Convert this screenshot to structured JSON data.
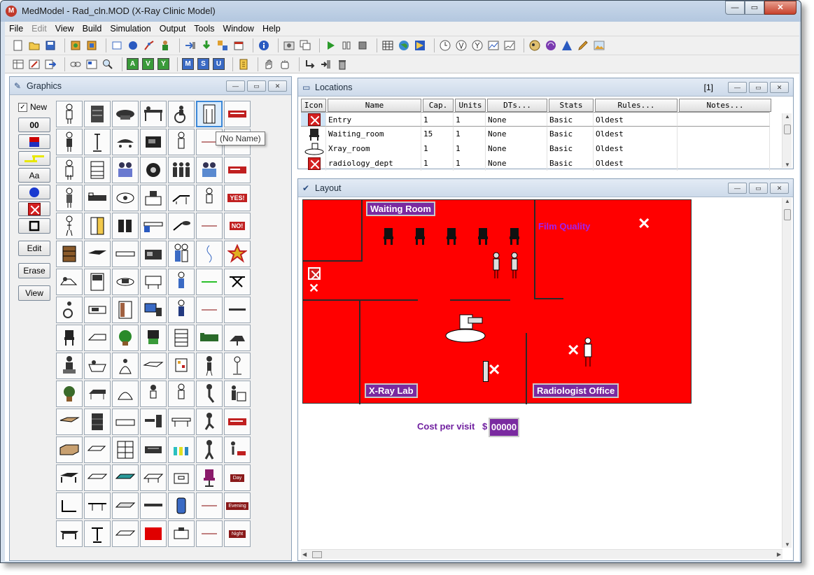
{
  "window": {
    "title": "MedModel - Rad_cln.MOD (X-Ray Clinic Model)",
    "app_icon_letter": "M",
    "minimize": "—",
    "maximize": "▭",
    "close": "✕"
  },
  "menu": [
    "File",
    "Edit",
    "View",
    "Build",
    "Simulation",
    "Output",
    "Tools",
    "Window",
    "Help"
  ],
  "toolbar2_letters": [
    "A",
    "V",
    "Y",
    "M",
    "S",
    "U"
  ],
  "graphics": {
    "title": "Graphics",
    "new_label": "New",
    "new_checked": "✓",
    "counter": "00",
    "text_tool": "Aa",
    "edit_button": "Edit",
    "erase_button": "Erase",
    "view_button": "View",
    "tooltip": "(No Name)",
    "badges": [
      "YES!",
      "NO!",
      "Day",
      "Evening",
      "Night"
    ]
  },
  "locations": {
    "title": "Locations",
    "record_indicator": "[1]",
    "columns": [
      "Icon",
      "Name",
      "Cap.",
      "Units",
      "DTs...",
      "Stats",
      "Rules...",
      "Notes..."
    ],
    "rows": [
      {
        "name": "Entry",
        "cap": "1",
        "units": "1",
        "dts": "None",
        "stats": "Basic",
        "rules": "Oldest",
        "notes": ""
      },
      {
        "name": "Waiting_room",
        "cap": "15",
        "units": "1",
        "dts": "None",
        "stats": "Basic",
        "rules": "Oldest",
        "notes": ""
      },
      {
        "name": "Xray_room",
        "cap": "1",
        "units": "1",
        "dts": "None",
        "stats": "Basic",
        "rules": "Oldest",
        "notes": ""
      },
      {
        "name": "radiology_dept",
        "cap": "1",
        "units": "1",
        "dts": "None",
        "stats": "Basic",
        "rules": "Oldest",
        "notes": ""
      }
    ]
  },
  "layout": {
    "title": "Layout",
    "rooms": {
      "waiting_room": "Waiting Room",
      "xray_lab": "X-Ray Lab",
      "radiologist_office": "Radiologist Office"
    },
    "film_quality_label": "Film Quality",
    "cost_label": "Cost per visit",
    "cost_currency": "$",
    "cost_value": "00000",
    "x_glyph": "✕"
  },
  "colors": {
    "floor": "#ff0000",
    "label_bg": "#7a2aa0",
    "film_quality": "#a020f0"
  }
}
